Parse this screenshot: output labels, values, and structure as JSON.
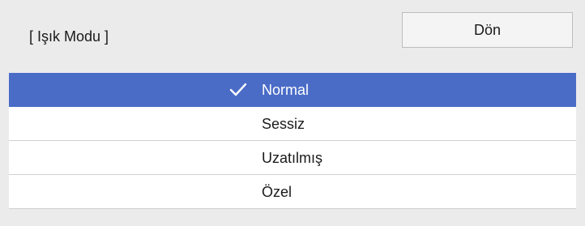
{
  "header": {
    "title": "[ Işık Modu ]",
    "back_label": "Dön"
  },
  "menu": {
    "selected_index": 0,
    "items": [
      {
        "label": "Normal",
        "selected": true
      },
      {
        "label": "Sessiz",
        "selected": false
      },
      {
        "label": "Uzatılmış",
        "selected": false
      },
      {
        "label": "Özel",
        "selected": false
      }
    ]
  },
  "colors": {
    "selection": "#4a6cc7",
    "background": "#ebebeb",
    "list_background": "#ffffff"
  },
  "icons": {
    "selected_marker": "check-icon"
  }
}
